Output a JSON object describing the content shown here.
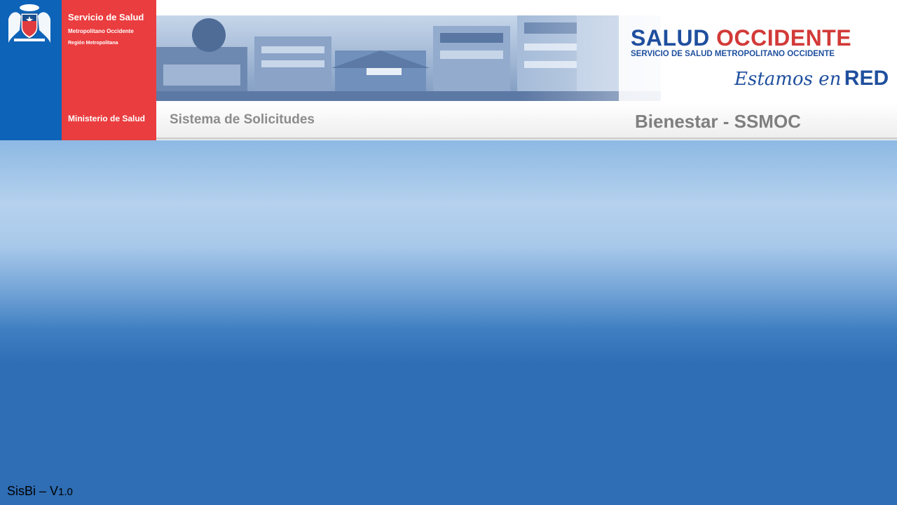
{
  "header": {
    "org_name": "Servicio de Salud",
    "org_subtitle": "Metropolitano Occidente",
    "org_region": "Región Metropolitana",
    "ministry": "Ministerio de Salud",
    "brand": {
      "title_word1": "SALUD",
      "title_word2": "OCCIDENTE",
      "subtitle": "SERVICIO DE SALUD METROPOLITANO OCCIDENTE",
      "slogan_script": "Estamos en",
      "slogan_bold": "RED"
    },
    "colors": {
      "blue": "#0d63b8",
      "red": "#ea3d3f",
      "brand_blue": "#1f4f9e",
      "brand_red": "#d23a38"
    }
  },
  "subheader": {
    "system_label": "Sistema de Solicitudes",
    "org_label": "Bienestar - SSMOC"
  },
  "footer": {
    "version_prefix": "SisBi – V",
    "version_number": "1.0"
  }
}
